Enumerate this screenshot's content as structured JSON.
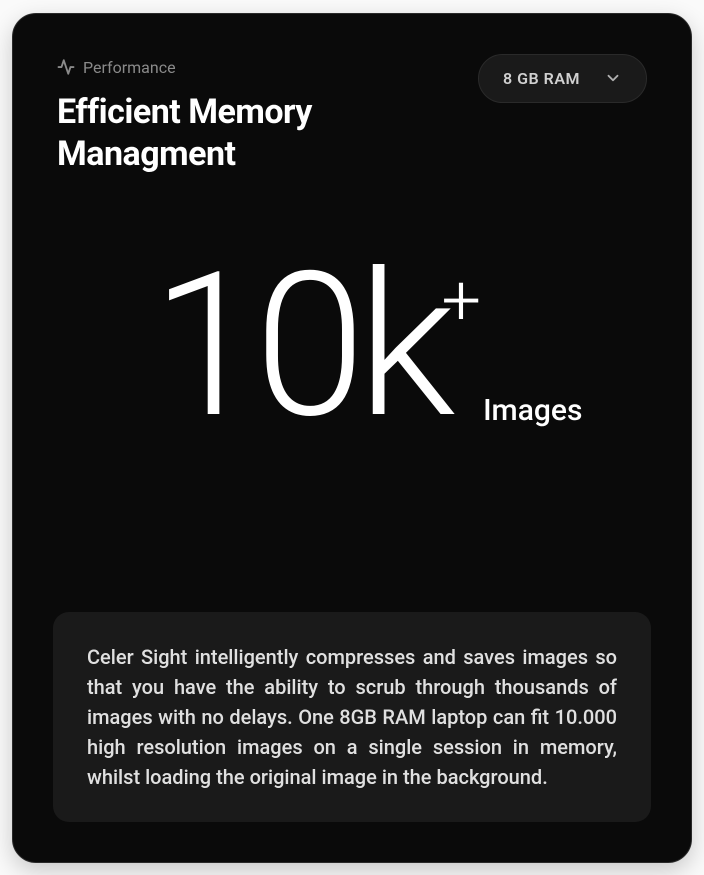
{
  "tag": {
    "label": "Performance"
  },
  "title": "Efficient Memory Managment",
  "dropdown": {
    "selected": "8 GB RAM"
  },
  "hero": {
    "value": "10k",
    "suffix": "+",
    "unit": "Images"
  },
  "description": "Celer Sight intelligently compresses and saves images so that you have the ability to scrub through thousands of images with no delays. One 8GB RAM laptop can fit 10.000 high resolution images on a single session in memory, whilst loading the original image in the background."
}
